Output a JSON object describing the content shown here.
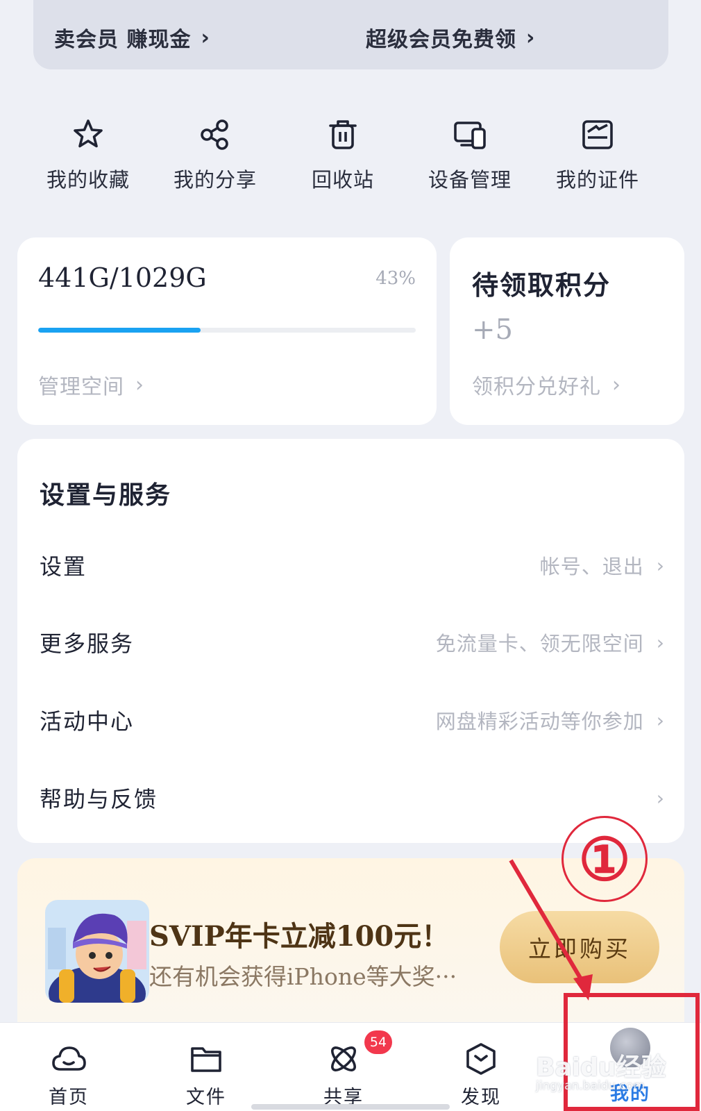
{
  "top_promo": {
    "left_label": "卖会员 赚现金",
    "right_label": "超级会员免费领",
    "chevron": "›"
  },
  "quick_actions": [
    {
      "label": "我的收藏",
      "icon": "star-icon"
    },
    {
      "label": "我的分享",
      "icon": "share-icon"
    },
    {
      "label": "回收站",
      "icon": "trash-icon"
    },
    {
      "label": "设备管理",
      "icon": "devices-icon"
    },
    {
      "label": "我的证件",
      "icon": "id-card-icon"
    }
  ],
  "storage": {
    "usage_text": "441G/1029G",
    "percent_text": "43%",
    "used_fraction": 0.43,
    "manage_label": "管理空间",
    "chevron": "›"
  },
  "points": {
    "title": "待领取积分",
    "value": "+5",
    "link_label": "领积分兑好礼",
    "chevron": "›"
  },
  "settings": {
    "title": "设置与服务",
    "rows": [
      {
        "label": "设置",
        "hint": "帐号、退出"
      },
      {
        "label": "更多服务",
        "hint": "免流量卡、领无限空间"
      },
      {
        "label": "活动中心",
        "hint": "网盘精彩活动等你参加"
      },
      {
        "label": "帮助与反馈",
        "hint": ""
      }
    ],
    "chevron": "›"
  },
  "svip_promo": {
    "title": "SVIP年卡立减100元！",
    "subtitle": "还有机会获得iPhone等大奖···",
    "button_label": "立即购买"
  },
  "tabbar": {
    "tabs": [
      {
        "label": "首页",
        "icon": "cloud-icon"
      },
      {
        "label": "文件",
        "icon": "folder-icon"
      },
      {
        "label": "共享",
        "icon": "atom-icon"
      },
      {
        "label": "发现",
        "icon": "cube-icon"
      },
      {
        "label": "我的",
        "icon": "avatar-icon",
        "active": true
      }
    ],
    "share_badge": "54"
  },
  "annotation": {
    "step_number": "①",
    "color": "#e0283c"
  },
  "watermark": {
    "main": "Baidu经验",
    "sub": "jingyan.baidu.com"
  },
  "colors": {
    "accent": "#2a7be4",
    "progress": "#1aa2f2",
    "badge": "#f2384d"
  }
}
